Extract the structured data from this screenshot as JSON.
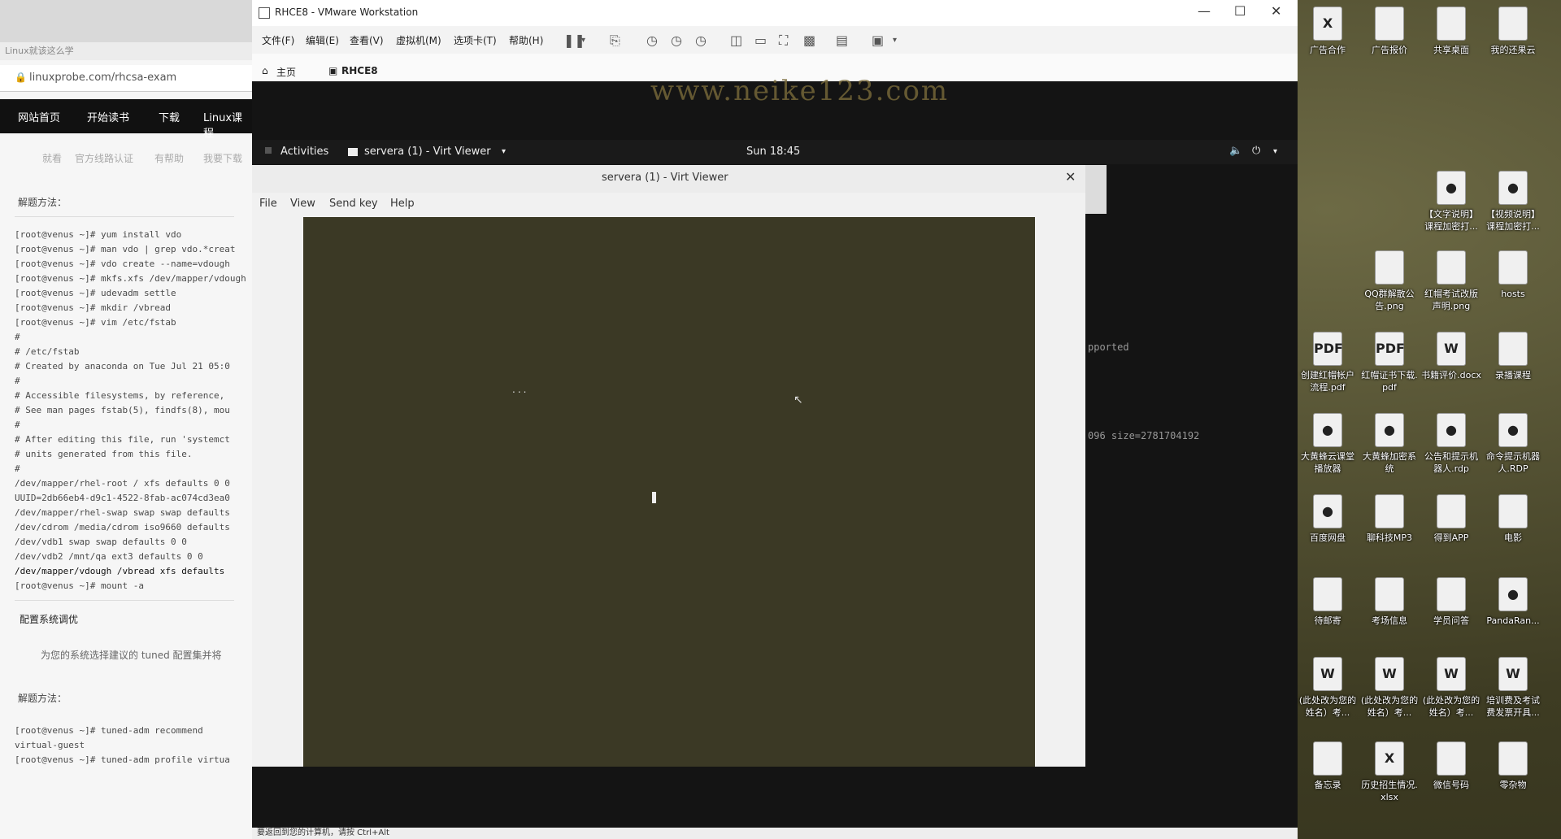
{
  "browser": {
    "tab_text": "Linux就该这么学",
    "url": "linuxprobe.com/rhcsa-exam",
    "nav": [
      "网站首页",
      "开始读书",
      "下载",
      "Linux课程"
    ],
    "breadcrumbs": [
      "就看",
      "官方线路认证",
      "有帮助",
      "我要下载"
    ],
    "method_label_1": "解题方法：",
    "terminal_1": [
      "[root@venus ~]# yum install vdo",
      "[root@venus ~]# man vdo | grep vdo.*creat",
      "[root@venus ~]# vdo create --name=vdough",
      "[root@venus ~]# mkfs.xfs /dev/mapper/vdough",
      "[root@venus ~]# udevadm settle",
      "[root@venus ~]# mkdir /vbread",
      "[root@venus ~]# vim /etc/fstab",
      "#",
      "# /etc/fstab",
      "# Created by anaconda on Tue Jul 21 05:0",
      "#",
      "# Accessible filesystems, by reference,",
      "# See man pages fstab(5), findfs(8), mou",
      "#",
      "# After editing this file, run 'systemct",
      "# units generated from this file.",
      "#",
      "/dev/mapper/rhel-root / xfs defaults 0 0",
      "UUID=2db66eb4-d9c1-4522-8fab-ac074cd3ea0",
      "/dev/mapper/rhel-swap swap swap defaults",
      "/dev/cdrom /media/cdrom iso9660 defaults",
      "/dev/vdb1 swap swap defaults 0 0",
      "/dev/vdb2 /mnt/qa ext3 defaults 0 0",
      "/dev/mapper/vdough /vbread xfs defaults",
      "[root@venus ~]# mount -a"
    ],
    "section_title": "配置系统调优",
    "section_desc": "为您的系统选择建议的 tuned 配置集并将",
    "method_label_2": "解题方法：",
    "terminal_2": [
      "[root@venus ~]# tuned-adm recommend",
      "virtual-guest",
      "[root@venus ~]# tuned-adm profile virtua"
    ]
  },
  "vmware": {
    "title": "RHCE8 - VMware Workstation",
    "menu": [
      "文件(F)",
      "编辑(E)",
      "查看(V)",
      "虚拟机(M)",
      "选项卡(T)",
      "帮助(H)"
    ],
    "tabs": [
      "主页",
      "RHCE8"
    ],
    "status_left": "要返回到您的计算机，请按 Ctrl+Alt",
    "watermark": "www.neike123.com"
  },
  "gnome": {
    "activities": "Activities",
    "app_name": "servera (1) - Virt Viewer",
    "clock": "Sun 18:45"
  },
  "vm_terminal": {
    "line1": "pported",
    "line2": "096 size=2781704192"
  },
  "virt_viewer": {
    "title": "servera (1) - Virt Viewer",
    "menu": [
      "File",
      "View",
      "Send key",
      "Help"
    ],
    "console_text": "..."
  },
  "desktop_icons": [
    {
      "label": "广告合作",
      "type": "excel"
    },
    {
      "label": "广告报价",
      "type": "file"
    },
    {
      "label": "共享桌面",
      "type": "file"
    },
    {
      "label": "我的还果云",
      "type": "file"
    },
    {
      "label": "【文字说明】课程加密打...",
      "type": "app"
    },
    {
      "label": "【视频说明】课程加密打...",
      "type": "app"
    },
    {
      "label": "QQ群解散公告.png",
      "type": "file"
    },
    {
      "label": "红帽考试改版声明.png",
      "type": "file"
    },
    {
      "label": "hosts",
      "type": "file"
    },
    {
      "label": "创建红帽帐户流程.pdf",
      "type": "pdf"
    },
    {
      "label": "红帽证书下载.pdf",
      "type": "pdf"
    },
    {
      "label": "书籍评价.docx",
      "type": "word"
    },
    {
      "label": "录播课程",
      "type": "file"
    },
    {
      "label": "大黄蜂云课堂播放器",
      "type": "app"
    },
    {
      "label": "大黄蜂加密系统",
      "type": "app"
    },
    {
      "label": "公告和提示机器人.rdp",
      "type": "app"
    },
    {
      "label": "命令提示机器人.RDP",
      "type": "app"
    },
    {
      "label": "百度网盘",
      "type": "app"
    },
    {
      "label": "聊科技MP3",
      "type": "file"
    },
    {
      "label": "得到APP",
      "type": "file"
    },
    {
      "label": "电影",
      "type": "file"
    },
    {
      "label": "待邮寄",
      "type": "file"
    },
    {
      "label": "考场信息",
      "type": "file"
    },
    {
      "label": "学员问答",
      "type": "file"
    },
    {
      "label": "PandaRan...",
      "type": "app"
    },
    {
      "label": "(此处改为您的姓名）考...",
      "type": "word"
    },
    {
      "label": "(此处改为您的姓名）考...",
      "type": "word"
    },
    {
      "label": "(此处改为您的姓名）考...",
      "type": "word"
    },
    {
      "label": "培训费及考试费发票开具...",
      "type": "word"
    },
    {
      "label": "备忘录",
      "type": "file"
    },
    {
      "label": "历史招生情况.xlsx",
      "type": "excel"
    },
    {
      "label": "微信号码",
      "type": "file"
    },
    {
      "label": "零杂物",
      "type": "file"
    }
  ]
}
